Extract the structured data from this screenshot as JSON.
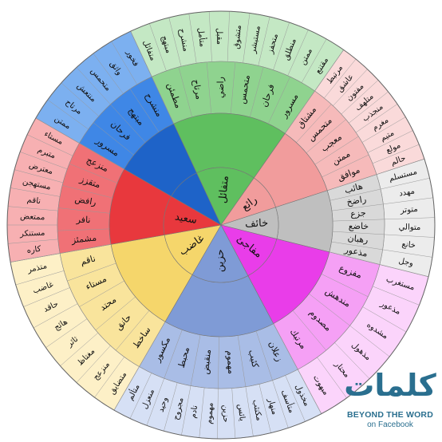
{
  "wheel": {
    "center_labels": [
      "خائف",
      "مفاجئ",
      "حزين",
      "غاضب",
      "سعيد",
      "متفائل",
      "رائع"
    ],
    "sectors": [
      {
        "key": "fear",
        "color": "#bfbfbf",
        "inner": "#d9d9d9",
        "outer": "#ececec",
        "words": [
          "هائب",
          "راضخ",
          "جزع",
          "خاضع",
          "رهبان",
          "مذعور"
        ],
        "outer_words": [
          "مستسلم",
          "مهدد",
          "متوتر",
          "متوالي",
          "خانع",
          "وجل"
        ]
      },
      {
        "key": "surprise",
        "color": "#e93de9",
        "inner": "#f5a0f5",
        "outer": "#fbd4fb",
        "words": [
          "مفزوع",
          "مندهش",
          "مصدوم",
          "مرتبك"
        ],
        "outer_words": [
          "مستغرب",
          "مذعور",
          "مشدوه",
          "مذهول",
          "محتار",
          "مبهوت"
        ]
      },
      {
        "key": "sad",
        "color": "#7f9bd6",
        "inner": "#a9bde6",
        "outer": "#d6e0f5",
        "words": [
          "زعلان",
          "كئيب",
          "مهموم",
          "منقبض",
          "محبط",
          "مكسور"
        ],
        "outer_words": [
          "مخذول",
          "متأسف",
          "منهار",
          "مكتئب",
          "يائس",
          "حزين",
          "مهموم",
          "نادم",
          "مجروح",
          "وحيد",
          "منعزل",
          "متألم"
        ]
      },
      {
        "key": "angry",
        "color": "#f5d66b",
        "inner": "#f9e49c",
        "outer": "#fdf0c7",
        "words": [
          "ساخط",
          "حانق",
          "محتد",
          "مستاء",
          "ناقم"
        ],
        "outer_words": [
          "متضايق",
          "منزعج",
          "مغتاظ",
          "ثائر",
          "هائج",
          "حاقد",
          "غاضب",
          "متذمر"
        ]
      },
      {
        "key": "disgust",
        "color": "#e8383d",
        "inner": "#f07176",
        "outer": "#f7b0b2",
        "words": [
          "مشمئز",
          "نافر",
          "رافض",
          "متقزز",
          "منزعج"
        ],
        "outer_words": [
          "كاره",
          "مستنكر",
          "ممتعض",
          "ناقم",
          "مستهجن",
          "معترض",
          "متبرم",
          "مستاء"
        ]
      },
      {
        "key": "happy",
        "color": "#1e63c8",
        "inner": "#3f87e6",
        "outer": "#7cb0f0",
        "words": [
          "مسرور",
          "فرحان",
          "مبتهج",
          "منشرح"
        ],
        "outer_words": [
          "ممتن",
          "مرتاح",
          "منتعش",
          "متحمس",
          "واثق",
          "فخور"
        ]
      },
      {
        "key": "optimistic",
        "color": "#5fbf5f",
        "inner": "#8fd38f",
        "outer": "#c4e8c4",
        "words": [
          "مطمئن",
          "مرتاح",
          "راضي",
          "متحمس",
          "فرحان",
          "مسرور"
        ],
        "outer_words": [
          "متفائل",
          "مبتهج",
          "منشرح",
          "متأمل",
          "مقبل",
          "متشوق",
          "مستبشر",
          "متحفز",
          "منطلق",
          "ممتن",
          "مقتنع"
        ]
      },
      {
        "key": "wonderful",
        "color": "#f19c9c",
        "inner": "#f6baba",
        "outer": "#fadada",
        "words": [
          "مشتاق",
          "متحمس",
          "معجب",
          "ممتن",
          "موافق"
        ],
        "outer_words": [
          "مرتبط",
          "عاشق",
          "مفتون",
          "متلهف",
          "منجذب",
          "مغرم",
          "متيم",
          "مولع",
          "حالم"
        ]
      }
    ]
  },
  "brand": {
    "logo_text": "كلمات",
    "title": "BEYOND THE WORD",
    "subtitle": "on Facebook",
    "logo_color": "#2a6f8f"
  }
}
